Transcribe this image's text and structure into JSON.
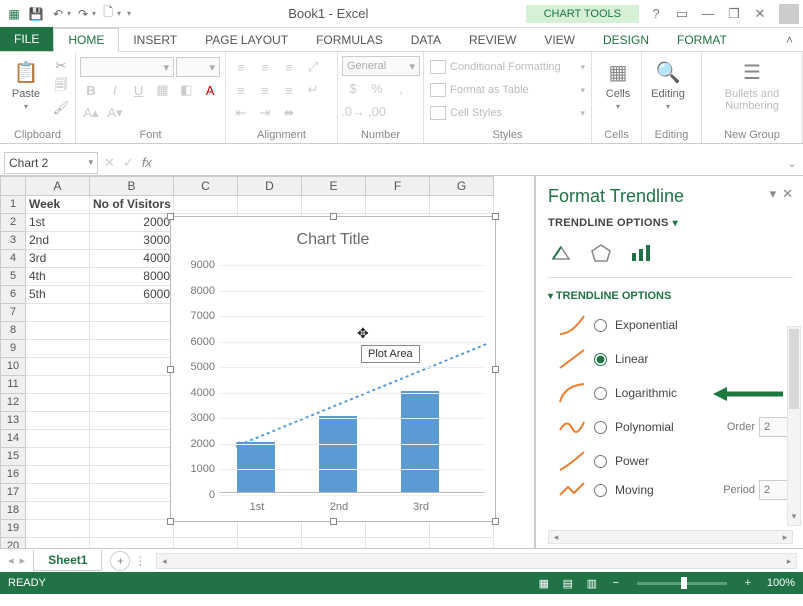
{
  "app": {
    "title": "Book1 - Excel",
    "chart_tools": "CHART TOOLS"
  },
  "tabs": {
    "file": "FILE",
    "home": "HOME",
    "insert": "INSERT",
    "page_layout": "PAGE LAYOUT",
    "formulas": "FORMULAS",
    "data": "DATA",
    "review": "REVIEW",
    "view": "VIEW",
    "design": "DESIGN",
    "format": "FORMAT"
  },
  "ribbon": {
    "clipboard": {
      "paste": "Paste",
      "label": "Clipboard"
    },
    "font": {
      "label": "Font"
    },
    "alignment": {
      "label": "Alignment"
    },
    "number": {
      "label": "Number",
      "format": "General"
    },
    "styles": {
      "label": "Styles",
      "cond": "Conditional Formatting",
      "table": "Format as Table",
      "cell": "Cell Styles"
    },
    "cells": {
      "btn": "Cells",
      "label": "Cells"
    },
    "editing": {
      "btn": "Editing",
      "label": "Editing"
    },
    "newgroup": {
      "btn": "Bullets and Numbering",
      "label": "New Group"
    }
  },
  "namebox": "Chart 2",
  "fx": "fx",
  "grid": {
    "cols": [
      "A",
      "B",
      "C",
      "D",
      "E",
      "F",
      "G"
    ],
    "header": {
      "a": "Week",
      "b": "No of Visitors"
    },
    "rows": [
      {
        "a": "1st",
        "b": "2000"
      },
      {
        "a": "2nd",
        "b": "3000"
      },
      {
        "a": "3rd",
        "b": "4000"
      },
      {
        "a": "4th",
        "b": "8000"
      },
      {
        "a": "5th",
        "b": "6000"
      }
    ]
  },
  "chart": {
    "title": "Chart Title",
    "tooltip": "Plot Area",
    "xcats": [
      "1st",
      "2nd",
      "3rd"
    ]
  },
  "chart_data": {
    "type": "bar",
    "categories": [
      "1st",
      "2nd",
      "3rd",
      "4th",
      "5th"
    ],
    "values": [
      2000,
      3000,
      4000,
      8000,
      6000
    ],
    "title": "Chart Title",
    "xlabel": "",
    "ylabel": "",
    "ylim": [
      0,
      9000
    ],
    "yticks": [
      0,
      1000,
      2000,
      3000,
      4000,
      5000,
      6000,
      7000,
      8000,
      9000
    ],
    "visible_bars": 3,
    "trendline": "linear"
  },
  "pane": {
    "title": "Format Trendline",
    "sub": "TRENDLINE OPTIONS",
    "section": "TRENDLINE OPTIONS",
    "opts": {
      "exp": "Exponential",
      "lin": "Linear",
      "log": "Logarithmic",
      "poly": "Polynomial",
      "pow": "Power",
      "mov": "Moving"
    },
    "order_label": "Order",
    "order_val": "2",
    "period_label": "Period",
    "period_val": "2",
    "selected": "lin"
  },
  "sheet": {
    "name": "Sheet1"
  },
  "status": {
    "ready": "READY",
    "zoom": "100%"
  }
}
